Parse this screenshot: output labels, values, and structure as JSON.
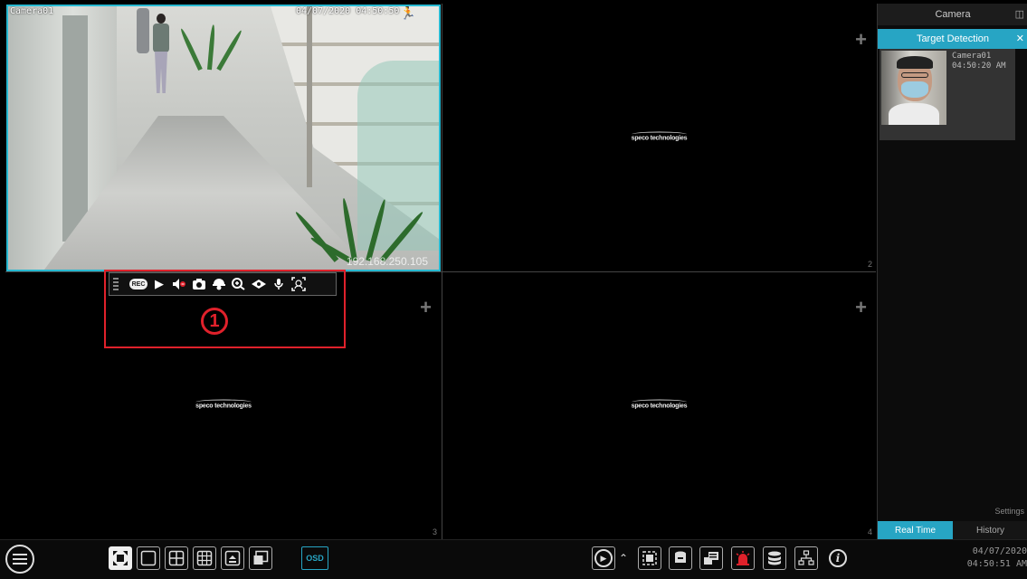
{
  "camera1": {
    "osd_name": "Camera01",
    "osd_time": "04/07/2020 04:50:50",
    "ip_watermark": "192.168.250.105",
    "motion_icon": "running-person-icon"
  },
  "cells": [
    {
      "number": "",
      "logo": ""
    },
    {
      "number": "2",
      "logo": "speco technologies"
    },
    {
      "number": "3",
      "logo": "speco technologies"
    },
    {
      "number": "4",
      "logo": "speco technologies"
    }
  ],
  "cell_add_glyph": "+",
  "camera_toolbar": {
    "rec_label": "REC",
    "icons": [
      "record-icon",
      "play-icon",
      "mute-icon",
      "snapshot-icon",
      "ptz-icon",
      "zoom-icon",
      "3d-zoom-icon",
      "talk-icon",
      "face-detect-icon"
    ]
  },
  "callout_number": "1",
  "side_panel": {
    "header": "Camera",
    "tab": "Target Detection",
    "detection": {
      "camera": "Camera01",
      "time": "04:50:20 AM"
    },
    "settings_label": "Settings",
    "tabs": [
      "Real Time",
      "History"
    ],
    "active_tab": "Real Time"
  },
  "taskbar": {
    "osd_label": "OSD",
    "layout_icons": [
      "fullscreen-icon",
      "single-view-icon",
      "quad-view-icon",
      "nine-view-icon",
      "sequence-icon",
      "pip-icon"
    ],
    "right_icons": [
      "playback-icon",
      "expand-icon",
      "screenshot-icon",
      "record-status-icon",
      "manual-alarm-icon",
      "alarm-icon",
      "disk-icon",
      "network-icon",
      "info-icon"
    ],
    "date": "04/07/2020",
    "time": "04:50:51 AM"
  },
  "colors": {
    "accent": "#27a5c4",
    "selection": "#27b9d1",
    "callout": "#e0212b",
    "motion": "#f4c400"
  }
}
